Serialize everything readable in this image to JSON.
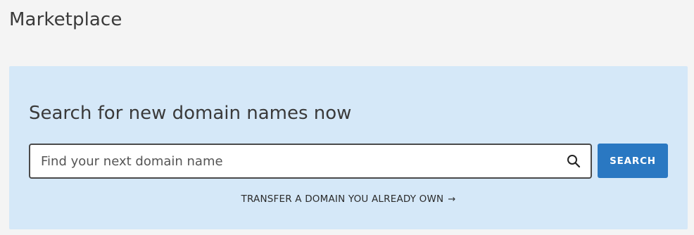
{
  "page": {
    "title": "Marketplace"
  },
  "search_panel": {
    "heading": "Search for new domain names now",
    "input": {
      "placeholder": "Find your next domain name",
      "value": ""
    },
    "search_icon": "search-icon",
    "button_label": "SEARCH",
    "transfer_link": {
      "label": "TRANSFER A DOMAIN YOU ALREADY OWN",
      "arrow": "→"
    }
  },
  "colors": {
    "page_background": "#f4f4f4",
    "panel_background": "#d5e8f8",
    "button_background": "#2a78c2",
    "input_border": "#4a4a4a"
  }
}
